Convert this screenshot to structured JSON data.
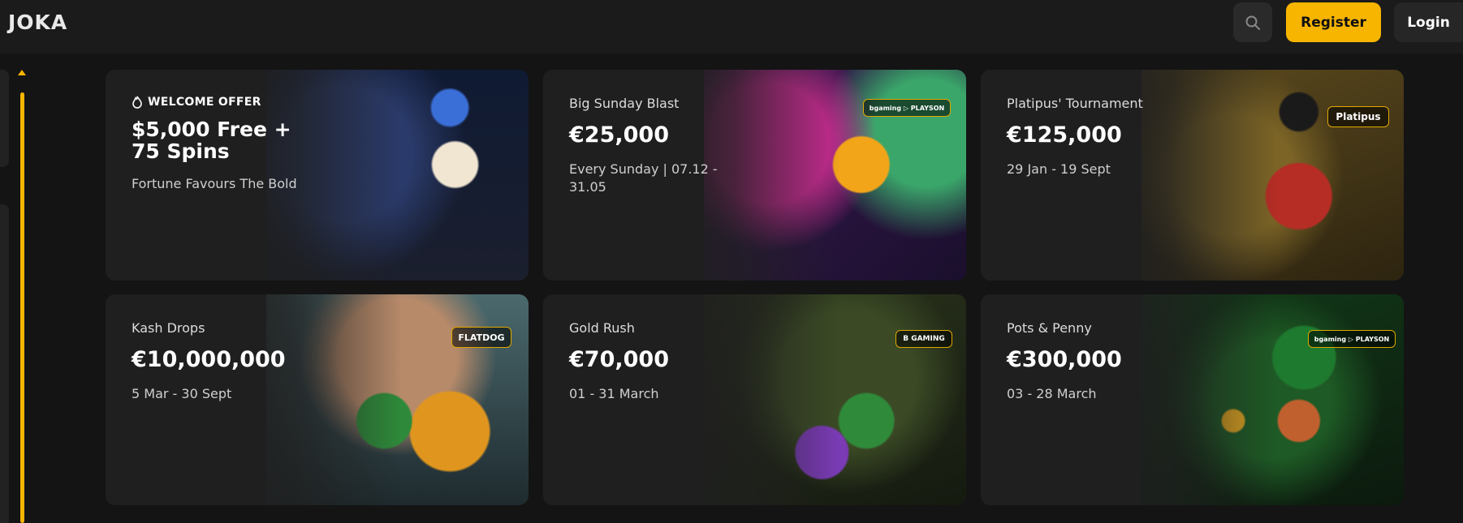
{
  "header": {
    "logo": "JOKA",
    "register_label": "Register",
    "login_label": "Login"
  },
  "cards": [
    {
      "tag": "WELCOME OFFER",
      "title_line1": "$5,000 Free +",
      "title_line2": "75 Spins",
      "subtitle": "Fortune Favours The Bold"
    },
    {
      "label": "Big Sunday Blast",
      "amount": "€25,000",
      "subtitle": "Every Sunday | 07.12 - 31.05",
      "badge": "bgaming ▷ PLAYSON"
    },
    {
      "label": "Platipus' Tournament",
      "amount": "€125,000",
      "subtitle": "29 Jan - 19 Sept",
      "badge": "Platipus"
    },
    {
      "label": "Kash Drops",
      "amount": "€10,000,000",
      "subtitle": "5 Mar - 30 Sept",
      "badge": "FLATDOG"
    },
    {
      "label": "Gold Rush",
      "amount": "€70,000",
      "subtitle": "01 - 31 March",
      "badge": "B GAMING"
    },
    {
      "label": "Pots & Penny",
      "amount": "€300,000",
      "subtitle": "03 - 28 March",
      "badge": "bgaming ▷ PLAYSON"
    }
  ],
  "colors": {
    "accent": "#f7b500",
    "background": "#141414",
    "card": "#1f1f1f"
  }
}
